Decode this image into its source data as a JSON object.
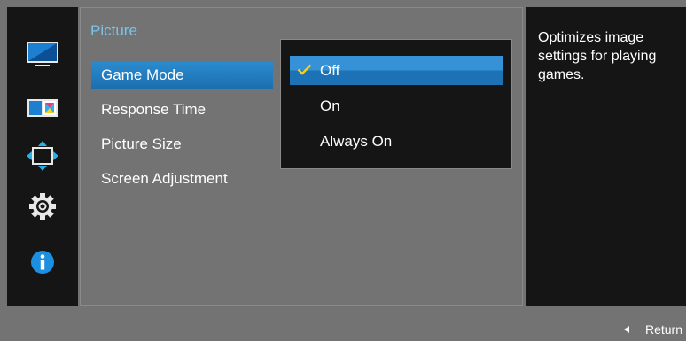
{
  "menu": {
    "title": "Picture",
    "items": [
      {
        "label": "Game Mode",
        "selected": true
      },
      {
        "label": "Response Time",
        "selected": false
      },
      {
        "label": "Picture Size",
        "selected": false
      },
      {
        "label": "Screen Adjustment",
        "selected": false
      }
    ]
  },
  "dropdown": {
    "options": [
      {
        "label": "Off",
        "checked": true
      },
      {
        "label": "On",
        "checked": false
      },
      {
        "label": "Always On",
        "checked": false
      }
    ]
  },
  "description": "Optimizes image settings for playing games.",
  "footer": {
    "return_label": "Return"
  },
  "sidebar_icons": [
    "picture-icon",
    "color-icon",
    "screen-size-icon",
    "system-settings-icon",
    "information-icon"
  ],
  "colors": {
    "accent": "#1f7bc2",
    "title": "#7ac3ea",
    "check": "#f5d020"
  }
}
